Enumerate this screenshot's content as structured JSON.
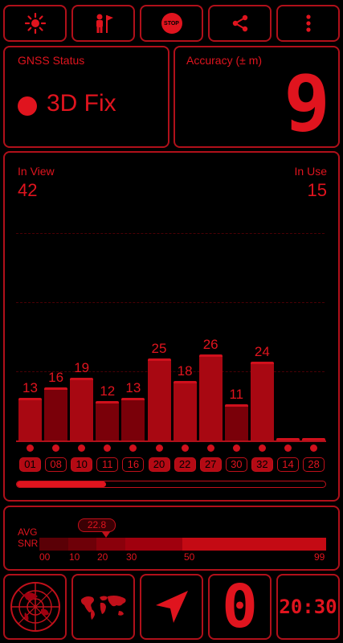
{
  "toolbar": {
    "items": [
      "brightness-icon",
      "person-flag-icon",
      "stop-icon",
      "share-icon",
      "overflow-menu-icon"
    ],
    "stop_label": "STOP"
  },
  "status": {
    "title": "GNSS Status",
    "fix": "3D Fix"
  },
  "accuracy": {
    "title": "Accuracy (± m)",
    "value": "9"
  },
  "satellites": {
    "in_view_label": "In View",
    "in_view": "42",
    "in_use_label": "In Use",
    "in_use": "15",
    "bars": [
      {
        "prn": "01",
        "snr": 13,
        "used": true
      },
      {
        "prn": "08",
        "snr": 16,
        "used": false
      },
      {
        "prn": "10",
        "snr": 19,
        "used": true
      },
      {
        "prn": "11",
        "snr": 12,
        "used": false
      },
      {
        "prn": "16",
        "snr": 13,
        "used": false
      },
      {
        "prn": "20",
        "snr": 25,
        "used": true
      },
      {
        "prn": "22",
        "snr": 18,
        "used": true
      },
      {
        "prn": "27",
        "snr": 26,
        "used": true
      },
      {
        "prn": "30",
        "snr": 11,
        "used": false
      },
      {
        "prn": "32",
        "snr": 24,
        "used": true
      },
      {
        "prn": "14",
        "snr": null,
        "used": false
      },
      {
        "prn": "28",
        "snr": null,
        "used": false
      }
    ],
    "progress": 0.29
  },
  "snr": {
    "avg_label": "AVG",
    "snr_label": "SNR",
    "avg_value": "22.8",
    "ticks": [
      "00",
      "10",
      "20",
      "30",
      "50",
      "99"
    ]
  },
  "bottom": {
    "speed": "0",
    "time": "20:30"
  },
  "colors": {
    "accent": "#e0141e",
    "dark": "#7a0009",
    "background": "#000000"
  }
}
